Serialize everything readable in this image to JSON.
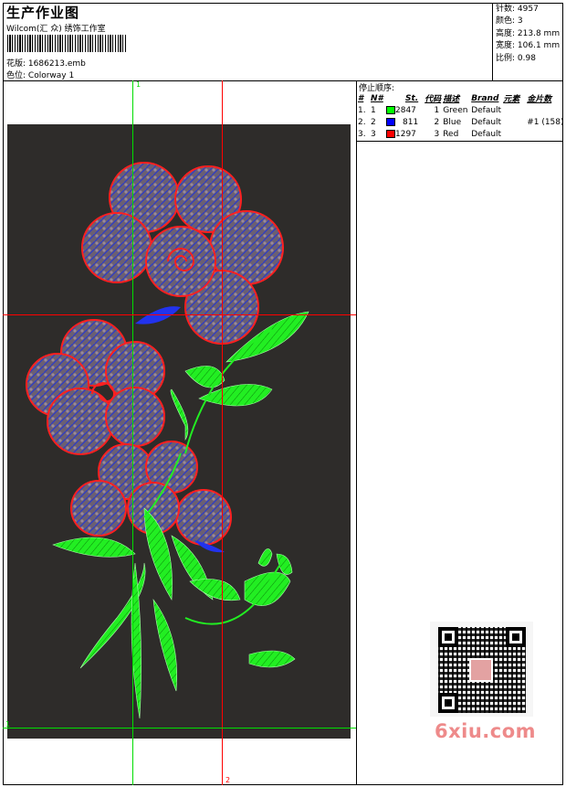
{
  "header": {
    "title": "生产作业图",
    "subtitle": "Wilcom(汇 众) 绣饰工作室",
    "pattern_label": "花版:",
    "pattern_value": "1686213.emb",
    "colorway_label": "色位:",
    "colorway_value": "Colorway 1"
  },
  "stats": [
    {
      "label": "针数:",
      "value": "4957"
    },
    {
      "label": "颜色:",
      "value": "3"
    },
    {
      "label": "高度:",
      "value": "213.8 mm"
    },
    {
      "label": "宽度:",
      "value": "106.1 mm"
    },
    {
      "label": "比例:",
      "value": "0.98"
    }
  ],
  "stop_sequence": {
    "title": "停止顺序:",
    "columns": [
      "#",
      "N#",
      "St.",
      "代码",
      "描述",
      "Brand",
      "元素",
      "金片数"
    ],
    "rows": [
      {
        "idx": "1.",
        "n": "1",
        "color": "#00ff00",
        "st": "2847",
        "code": "1",
        "desc": "Green",
        "brand": "Default",
        "element": "",
        "sequins": ""
      },
      {
        "idx": "2.",
        "n": "2",
        "color": "#0000ff",
        "st": "811",
        "code": "2",
        "desc": "Blue",
        "brand": "Default",
        "element": "",
        "sequins": "#1 (158)"
      },
      {
        "idx": "3.",
        "n": "3",
        "color": "#ff0000",
        "st": "1297",
        "code": "3",
        "desc": "Red",
        "brand": "Default",
        "element": "",
        "sequins": ""
      }
    ]
  },
  "guides": {
    "green_label": "1",
    "green_label_left": "1",
    "red_label": "2",
    "green_color": "#00dd00",
    "red_color": "#ff0000"
  },
  "watermark": "6xiu.com"
}
